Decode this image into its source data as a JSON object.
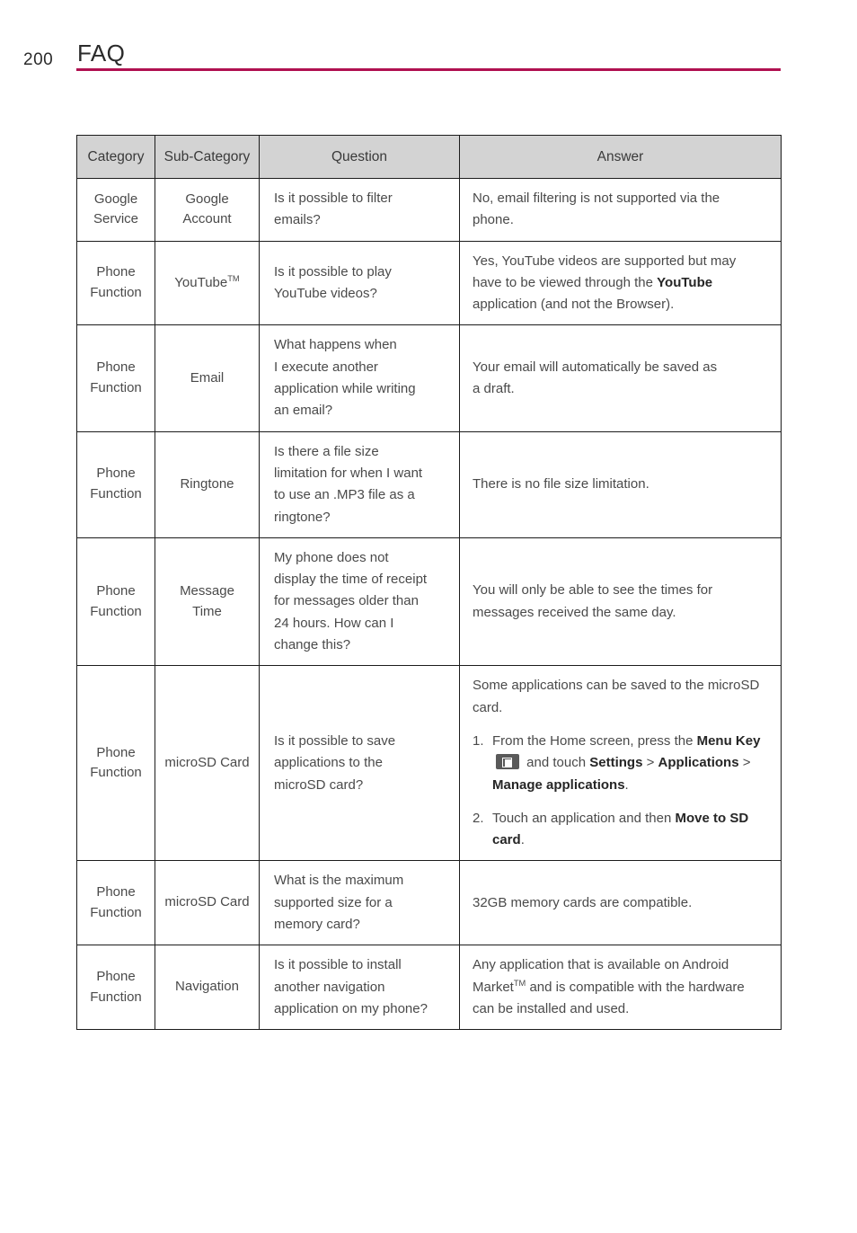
{
  "header": {
    "page_number": "200",
    "title": "FAQ",
    "rule_color": "#b01050"
  },
  "table": {
    "headers": [
      "Category",
      "Sub-Category",
      "Question",
      "Answer"
    ],
    "header_bg": "#d3d3d3",
    "rows": [
      {
        "category": [
          "Google",
          "Service"
        ],
        "subcategory": [
          "Google",
          "Account"
        ],
        "question": [
          "Is it possible to filter",
          "emails?"
        ],
        "answer": [
          "No, email filtering is not supported via the",
          "phone."
        ]
      },
      {
        "category": [
          "Phone",
          "Function"
        ],
        "subcategory_html": "YouTube<sup class=\"tm\">TM</sup>",
        "question": [
          "Is it possible to play",
          "YouTube videos?"
        ],
        "answer_html": "Yes, YouTube videos are supported but may have to be viewed through the <b>YouTube</b> application (and not the Browser)."
      },
      {
        "category": [
          "Phone",
          "Function"
        ],
        "subcategory": [
          "Email"
        ],
        "question": [
          "What happens when",
          "I execute another",
          "application while writing",
          "an email?"
        ],
        "answer": [
          "Your email will automatically be saved as",
          "a draft."
        ]
      },
      {
        "category": [
          "Phone",
          "Function"
        ],
        "subcategory": [
          "Ringtone"
        ],
        "question": [
          "Is there a file size",
          "limitation for when I want",
          "to use an .MP3 file as a",
          "ringtone?"
        ],
        "answer": [
          "There is no file size limitation."
        ]
      },
      {
        "category": [
          "Phone",
          "Function"
        ],
        "subcategory": [
          "Message",
          "Time"
        ],
        "question": [
          "My phone does not",
          "display the time of receipt",
          "for messages older than",
          "24 hours. How can I",
          "change this?"
        ],
        "answer": [
          "You will only be able to see the times for",
          "messages received the same day."
        ]
      },
      {
        "category": [
          "Phone",
          "Function"
        ],
        "subcategory": [
          "microSD Card"
        ],
        "question": [
          "Is it possible to save",
          "applications to the",
          "microSD card?"
        ],
        "answer_intro": "Some applications can be saved to the microSD card.",
        "answer_steps": [
          {
            "num": "1.",
            "html": "From the Home screen, press the <b>Menu Key</b> <span class=\"menu-key-icon\" data-name=\"menu-key-icon\" data-interactable=\"false\"></span> and touch <b>Settings</b> &gt; <b>Applications</b> &gt; <b>Manage applications</b>."
          },
          {
            "num": "2.",
            "html": "Touch an application and then <b>Move to SD card</b>."
          }
        ]
      },
      {
        "category": [
          "Phone",
          "Function"
        ],
        "subcategory": [
          "microSD Card"
        ],
        "question": [
          "What is the maximum",
          "supported size for a",
          "memory card?"
        ],
        "answer": [
          "32GB memory cards are compatible."
        ]
      },
      {
        "category": [
          "Phone",
          "Function"
        ],
        "subcategory": [
          "Navigation"
        ],
        "question": [
          "Is it possible to install",
          "another navigation",
          "application on my phone?"
        ],
        "answer_html": "Any application that is available on Android Market<sup class=\"tm\">TM</sup> and is compatible with the hardware can be installed and used."
      }
    ]
  }
}
